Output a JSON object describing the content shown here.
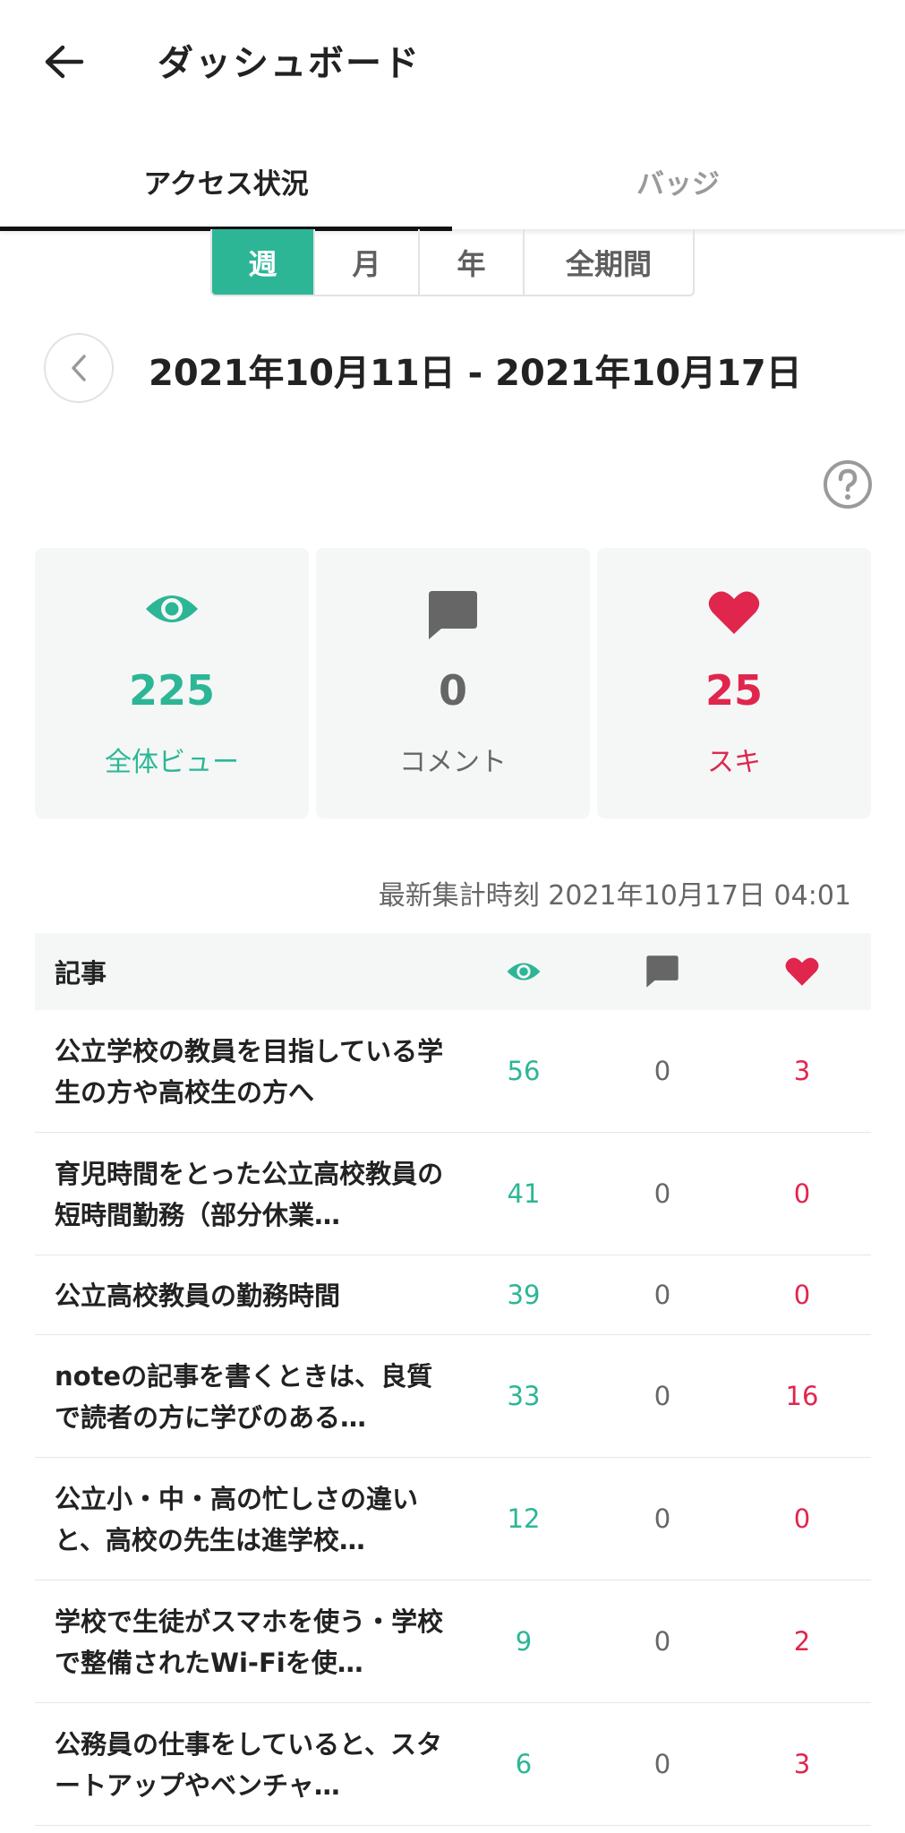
{
  "header": {
    "title": "ダッシュボード",
    "back_icon": "arrow-left-icon"
  },
  "tabs": [
    {
      "label": "アクセス状況",
      "active": true
    },
    {
      "label": "バッジ",
      "active": false
    }
  ],
  "period": {
    "options": [
      "週",
      "月",
      "年",
      "全期間"
    ],
    "selected": "週"
  },
  "date_range": "2021年10月11日 - 2021年10月17日",
  "stats": {
    "views": {
      "value": "225",
      "label": "全体ビュー",
      "icon": "eye-icon",
      "color": "#2cb696"
    },
    "comments": {
      "value": "0",
      "label": "コメント",
      "icon": "comment-icon",
      "color": "#666666"
    },
    "likes": {
      "value": "25",
      "label": "スキ",
      "icon": "heart-icon",
      "color": "#e0264d"
    }
  },
  "updated": "最新集計時刻 2021年10月17日 04:01",
  "table": {
    "header": "記事",
    "rows": [
      {
        "title": "公立学校の教員を目指している学生の方や高校生の方へ",
        "views": "56",
        "comments": "0",
        "likes": "3"
      },
      {
        "title": "育児時間をとった公立高校教員の短時間勤務（部分休業…",
        "views": "41",
        "comments": "0",
        "likes": "0"
      },
      {
        "title": "公立高校教員の勤務時間",
        "views": "39",
        "comments": "0",
        "likes": "0"
      },
      {
        "title": "noteの記事を書くときは、良質で読者の方に学びのある…",
        "views": "33",
        "comments": "0",
        "likes": "16"
      },
      {
        "title": "公立小・中・高の忙しさの違いと、高校の先生は進学校…",
        "views": "12",
        "comments": "0",
        "likes": "0"
      },
      {
        "title": "学校で生徒がスマホを使う・学校で整備されたWi-Fiを使…",
        "views": "9",
        "comments": "0",
        "likes": "2"
      },
      {
        "title": "公務員の仕事をしていると、スタートアップやベンチャ…",
        "views": "6",
        "comments": "0",
        "likes": "3"
      }
    ]
  }
}
